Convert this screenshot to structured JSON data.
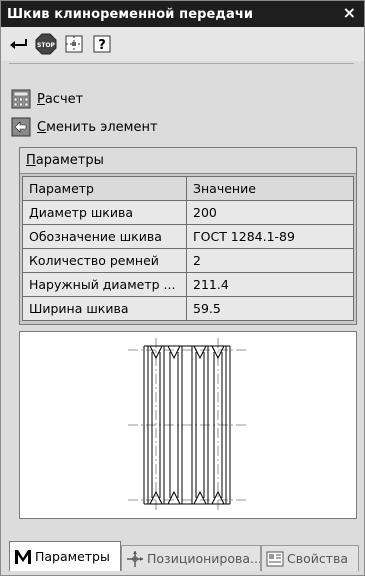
{
  "window": {
    "title": "Шкив клиноременной передачи",
    "close_glyph": "×"
  },
  "toolbar": {
    "icons": [
      "enter-icon",
      "stop-icon",
      "grid-icon",
      "help-icon"
    ],
    "stop_text": "STOP",
    "help_text": "?"
  },
  "actions": {
    "calculate": {
      "hotkey": "Р",
      "rest": "асчет",
      "icon": "calculator-icon"
    },
    "change_element": {
      "hotkey": "С",
      "rest": "менить элемент",
      "icon": "change-element-icon"
    }
  },
  "params_panel": {
    "title_hotkey": "П",
    "title_rest": "араметры",
    "header": [
      "Параметр",
      "Значение"
    ],
    "rows": [
      [
        "Диаметр шкива",
        "200"
      ],
      [
        "Обозначение шкива",
        "ГОСТ 1284.1-89"
      ],
      [
        "Количество ремней",
        "2"
      ],
      [
        "Наружный диаметр ...",
        "211.4"
      ],
      [
        "Ширина шкива",
        "59.5"
      ]
    ]
  },
  "tabs": [
    {
      "label": "Параметры",
      "icon": "parameters-icon",
      "active": true
    },
    {
      "label": "Позиционирова...",
      "icon": "positioning-icon",
      "active": false
    },
    {
      "label": "Свойства",
      "icon": "properties-icon",
      "active": false
    }
  ],
  "colors": {
    "titlebar": "#1e1e1e",
    "panel_bg": "#dcdcdc",
    "grid_line": "#6f6f6f"
  }
}
